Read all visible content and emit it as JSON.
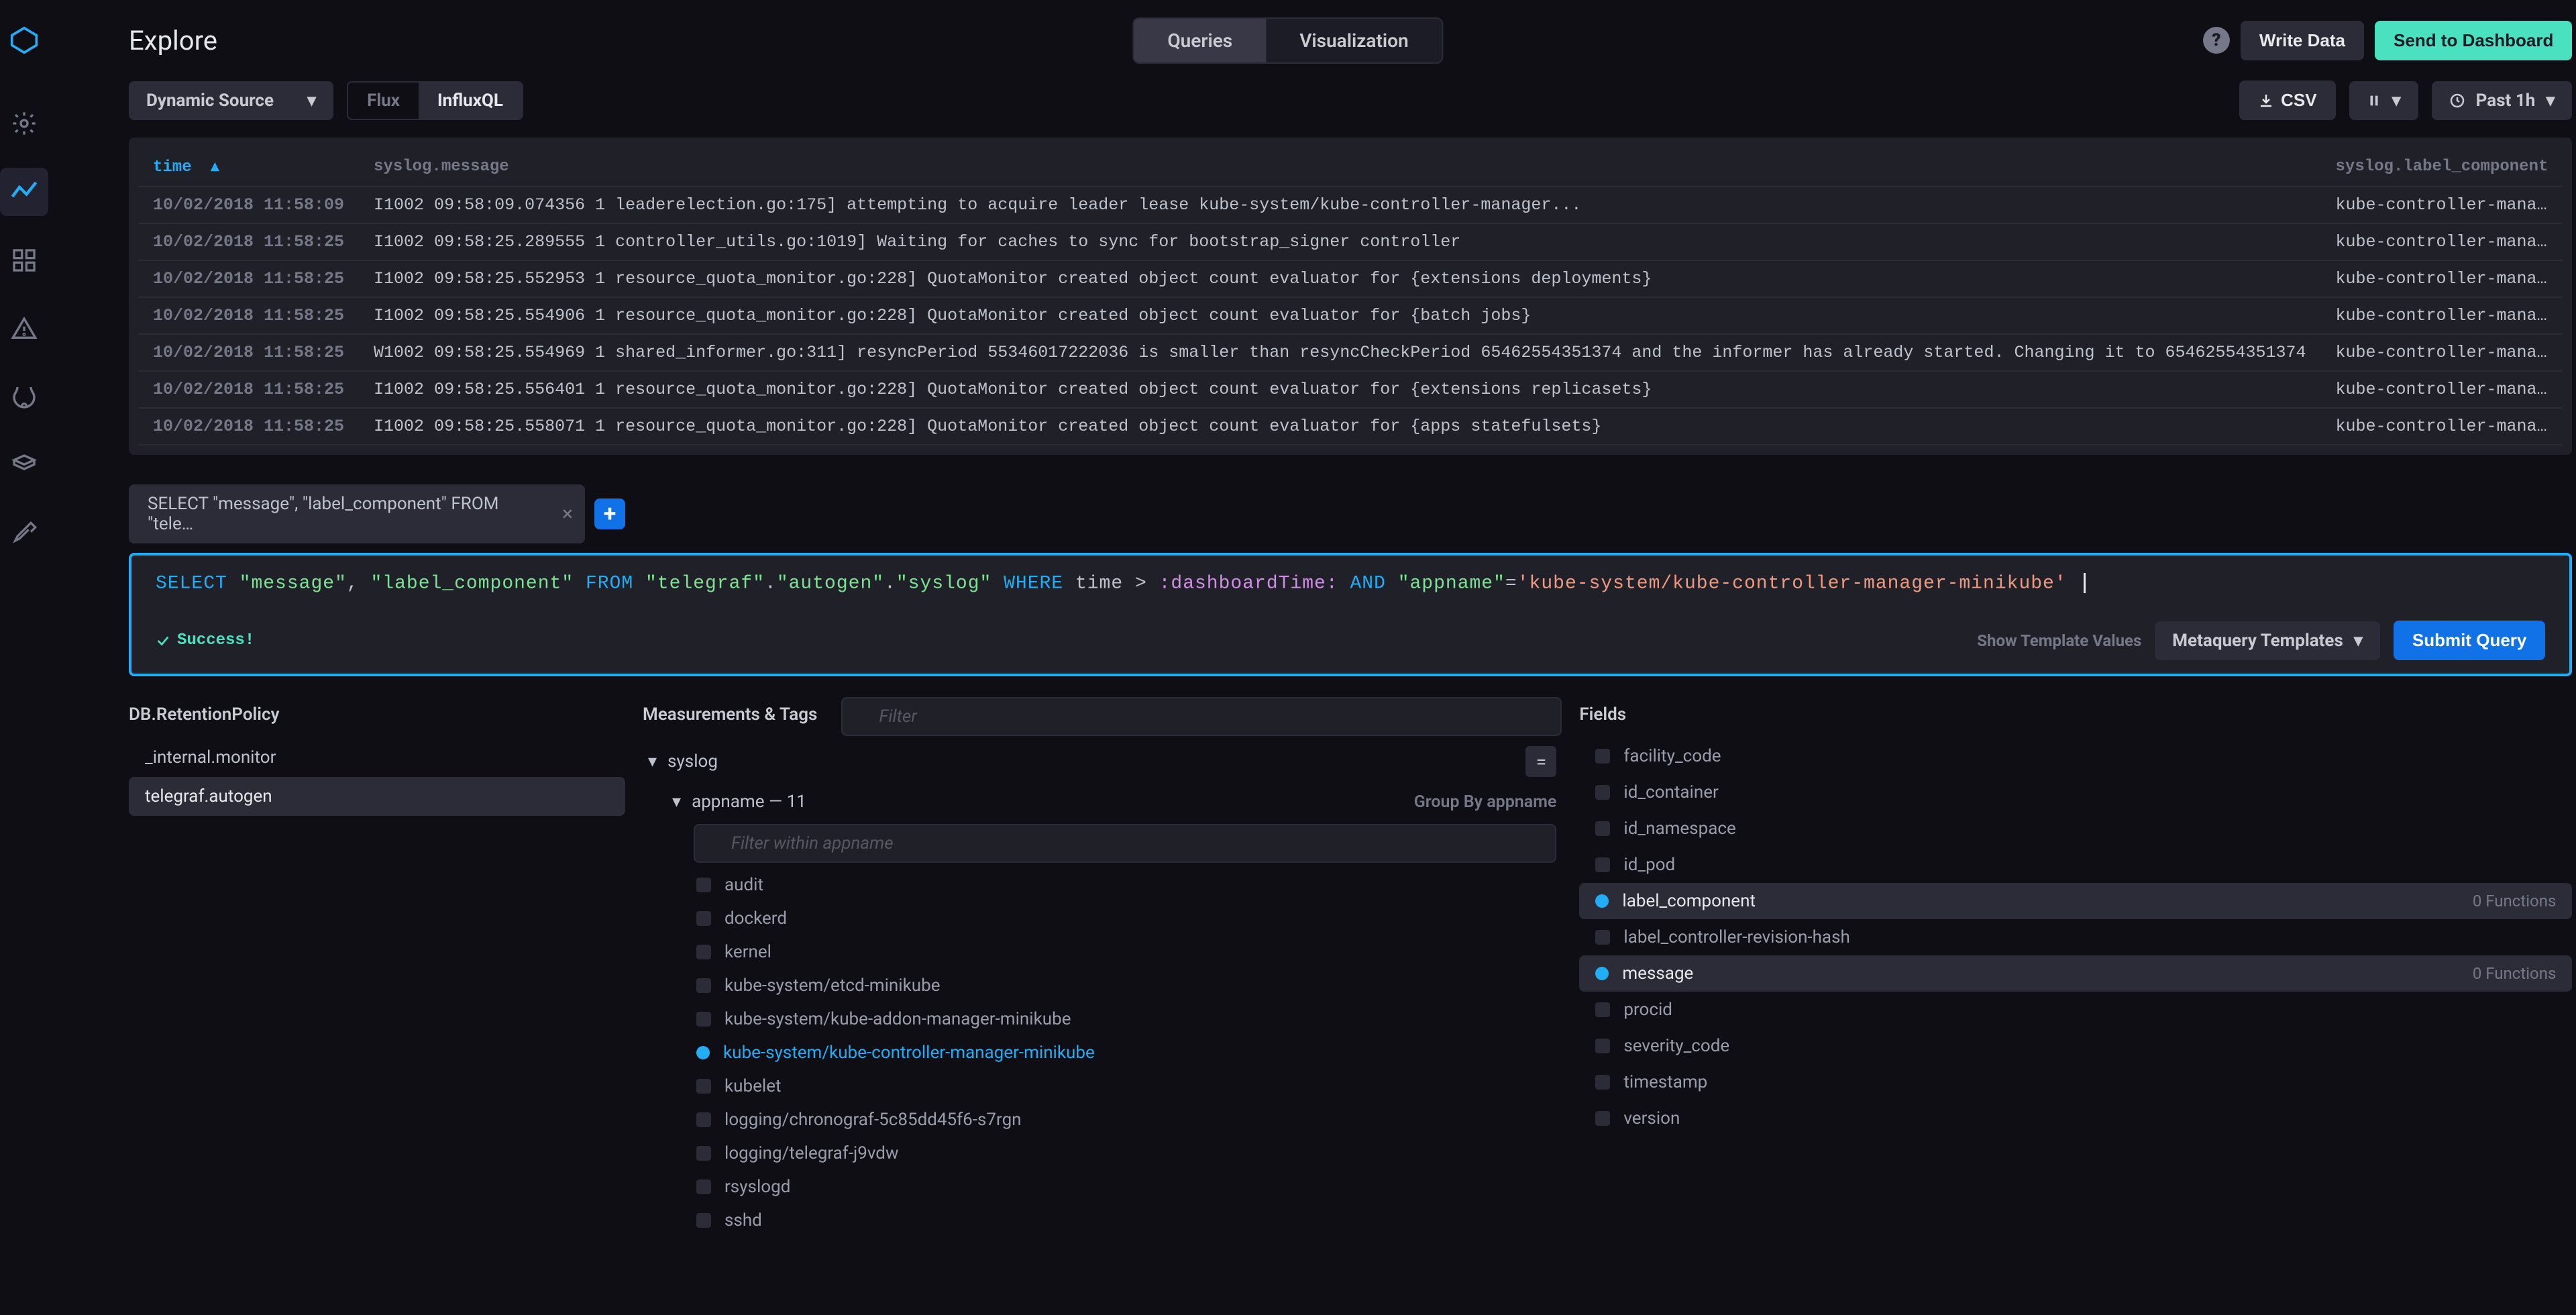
{
  "page_title": "Explore",
  "view_toggle": {
    "queries": "Queries",
    "visualization": "Visualization"
  },
  "top_buttons": {
    "write_data": "Write Data",
    "send_dashboard": "Send to Dashboard"
  },
  "source_dropdown": "Dynamic Source",
  "lang": {
    "flux": "Flux",
    "influxql": "InfluxQL"
  },
  "csv": "CSV",
  "past": "Past 1h",
  "columns": {
    "time": "time",
    "message": "syslog.message",
    "component": "syslog.label_component"
  },
  "rows": [
    {
      "t": "10/02/2018 11:58:09",
      "m": "I1002 09:58:09.074356 1 leaderelection.go:175] attempting to acquire leader lease kube-system/kube-controller-manager...",
      "c": "kube-controller-mana…"
    },
    {
      "t": "10/02/2018 11:58:25",
      "m": "I1002 09:58:25.289555 1 controller_utils.go:1019] Waiting for caches to sync for bootstrap_signer controller",
      "c": "kube-controller-mana…"
    },
    {
      "t": "10/02/2018 11:58:25",
      "m": "I1002 09:58:25.552953 1 resource_quota_monitor.go:228] QuotaMonitor created object count evaluator for {extensions deployments}",
      "c": "kube-controller-mana…"
    },
    {
      "t": "10/02/2018 11:58:25",
      "m": "I1002 09:58:25.554906 1 resource_quota_monitor.go:228] QuotaMonitor created object count evaluator for {batch jobs}",
      "c": "kube-controller-mana…"
    },
    {
      "t": "10/02/2018 11:58:25",
      "m": "W1002 09:58:25.554969 1 shared_informer.go:311] resyncPeriod 55346017222036 is smaller than resyncCheckPeriod 65462554351374 and the informer has already started. Changing it to 65462554351374",
      "c": "kube-controller-mana…"
    },
    {
      "t": "10/02/2018 11:58:25",
      "m": "I1002 09:58:25.556401 1 resource_quota_monitor.go:228] QuotaMonitor created object count evaluator for {extensions replicasets}",
      "c": "kube-controller-mana…"
    },
    {
      "t": "10/02/2018 11:58:25",
      "m": "I1002 09:58:25.558071 1 resource_quota_monitor.go:228] QuotaMonitor created object count evaluator for {apps statefulsets}",
      "c": "kube-controller-mana…"
    }
  ],
  "tab_label": "SELECT \"message\", \"label_component\" FROM \"tele…",
  "query_parts": {
    "select": "SELECT",
    "f1": "\"message\"",
    "comma": ", ",
    "f2": "\"label_component\"",
    "from": "FROM",
    "db": "\"telegraf\"",
    "dot1": ".",
    "rp": "\"autogen\"",
    "dot2": ".",
    "meas": "\"syslog\"",
    "where": "WHERE",
    "time": "time",
    "gt": ">",
    "tmpl": ":dashboardTime:",
    "and": "AND",
    "tag": "\"appname\"",
    "eq": "=",
    "val": "'kube-system/kube-controller-manager-minikube'"
  },
  "success_text": "Success!",
  "show_tmpl": "Show Template Values",
  "metaquery": "Metaquery Templates",
  "submit": "Submit Query",
  "panels": {
    "db": "DB.RetentionPolicy",
    "mt": "Measurements & Tags",
    "fields": "Fields",
    "filter": "Filter",
    "filter_appname": "Filter within appname"
  },
  "dbs": [
    "_internal.monitor",
    "telegraf.autogen"
  ],
  "measurement": "syslog",
  "tag_key": "appname — 11",
  "group_by": "Group By appname",
  "appnames": [
    "audit",
    "dockerd",
    "kernel",
    "kube-system/etcd-minikube",
    "kube-system/kube-addon-manager-minikube",
    "kube-system/kube-controller-manager-minikube",
    "kubelet",
    "logging/chronograf-5c85dd45f6-s7rgn",
    "logging/telegraf-j9vdw",
    "rsyslogd",
    "sshd"
  ],
  "appname_selected": 5,
  "fields": [
    "facility_code",
    "id_container",
    "id_namespace",
    "id_pod",
    "label_component",
    "label_controller-revision-hash",
    "message",
    "procid",
    "severity_code",
    "timestamp",
    "version"
  ],
  "fields_selected": [
    4,
    6
  ],
  "fn_label": "0 Functions"
}
